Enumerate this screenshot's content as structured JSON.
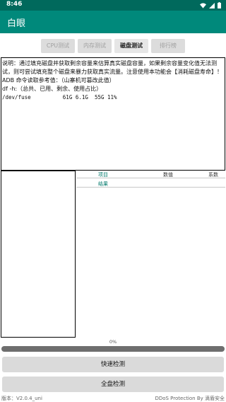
{
  "status_bar": {
    "time": "8:46",
    "icons": [
      "wifi-icon",
      "signal-icon",
      "battery-icon"
    ]
  },
  "app": {
    "title": "白眼"
  },
  "tabs": [
    {
      "label": "CPU测试",
      "active": false
    },
    {
      "label": "内存测试",
      "active": false
    },
    {
      "label": "磁盘测试",
      "active": true
    },
    {
      "label": "排行榜",
      "active": false
    }
  ],
  "info": {
    "description": "说明：通过填充磁盘并获取剩余容量来估算真实磁盘容量，如果剩余容量变化值无法测试，则可尝试填充整个磁盘来暴力获取真实流量。注意使用本功能会【消耗磁盘寿命】！",
    "adb_title": "ADB 命令读取参考值：（山寨机可篡改此值）",
    "df_command": "df -h:（总共、已用、剩余、使用占比）",
    "df_output": "/dev/fuse          61G 6.1G  55G 11%"
  },
  "table": {
    "columns": [
      "项目",
      "数值",
      "系数"
    ],
    "result_label": "结果"
  },
  "progress": {
    "percent_text": "0%",
    "value": 0
  },
  "buttons": {
    "quick_check": "快速检测",
    "full_check": "全盘检测"
  },
  "footer": {
    "version": "版本：V2.0.4_uni",
    "brand": "DDoS Protection By 滴盾安全"
  },
  "colors": {
    "status_bar": "#00695c",
    "app_bar": "#00897b",
    "accent_text": "#00796b",
    "button_bg": "#dadada"
  }
}
